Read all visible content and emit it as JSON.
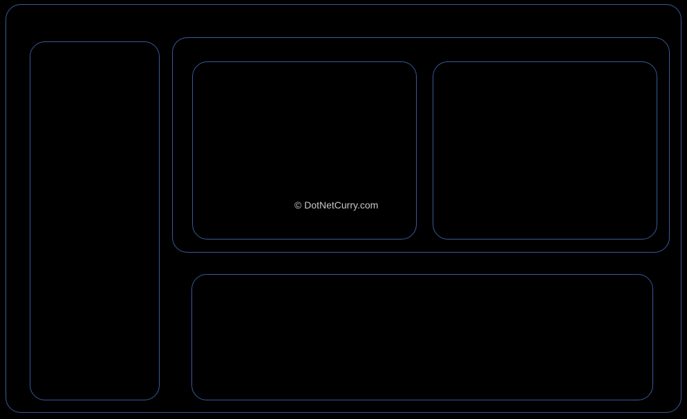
{
  "watermark": "© DotNetCurry.com"
}
